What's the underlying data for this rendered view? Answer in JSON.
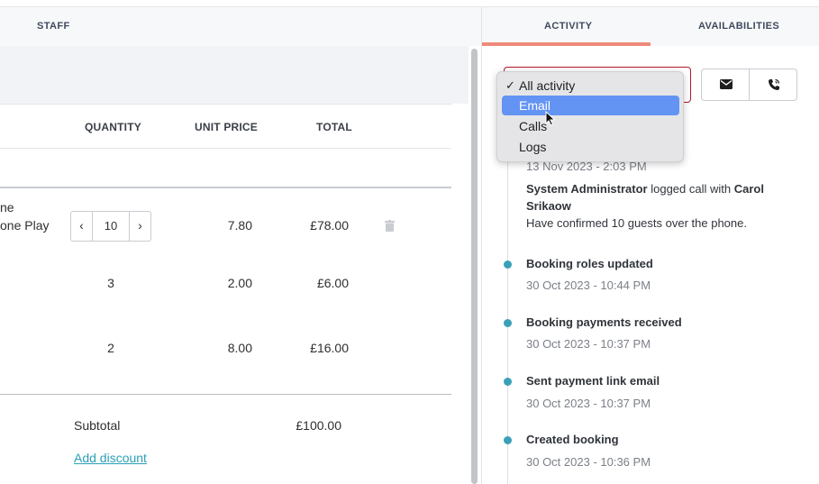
{
  "left_tabs": {
    "staff": "STAFF"
  },
  "table": {
    "headers": {
      "quantity": "QUANTITY",
      "unit_price": "UNIT PRICE",
      "total": "TOTAL"
    },
    "rows": [
      {
        "name_line1": "ne",
        "name_line2": "one Play",
        "quantity": "10",
        "unit_price": "7.80",
        "total": "£78.00"
      },
      {
        "quantity": "3",
        "unit_price": "2.00",
        "total": "£6.00"
      },
      {
        "quantity": "2",
        "unit_price": "8.00",
        "total": "£16.00"
      }
    ],
    "stepper_dec": "‹",
    "stepper_inc": "›"
  },
  "summary": {
    "subtotal_label": "Subtotal",
    "subtotal_value": "£100.00",
    "add_discount": "Add discount"
  },
  "right_tabs": {
    "activity": "ACTIVITY",
    "availabilities": "AVAILABILITIES"
  },
  "activity_filter": {
    "options": [
      "All activity",
      "Email",
      "Calls",
      "Logs"
    ],
    "checked": "All activity",
    "highlighted": "Email",
    "check_mark": "✓"
  },
  "timeline": [
    {
      "time": "13 Nov 2023 - 2:03 PM",
      "actor": "System Administrator",
      "action": " logged call with ",
      "target": "Carol",
      "target2": "Srikaow",
      "note": "Have confirmed 10 guests over the phone."
    },
    {
      "title": "Booking roles updated",
      "time": "30 Oct 2023 - 10:44 PM"
    },
    {
      "title": "Booking payments received",
      "time": "30 Oct 2023 - 10:37 PM"
    },
    {
      "title": "Sent payment link email",
      "time": "30 Oct 2023 - 10:37 PM"
    },
    {
      "title": "Created booking",
      "time": "30 Oct 2023 - 10:36 PM"
    }
  ],
  "colors": {
    "accent_underline": "#ef8a7b",
    "select_border": "#b4182a",
    "timeline_dot": "#3aa0b8",
    "link": "#2aa0b8",
    "dropdown_highlight": "#6393f3"
  },
  "icons": {
    "email_button": "envelope-icon",
    "call_button": "phone-icon",
    "delete": "trash-icon"
  }
}
